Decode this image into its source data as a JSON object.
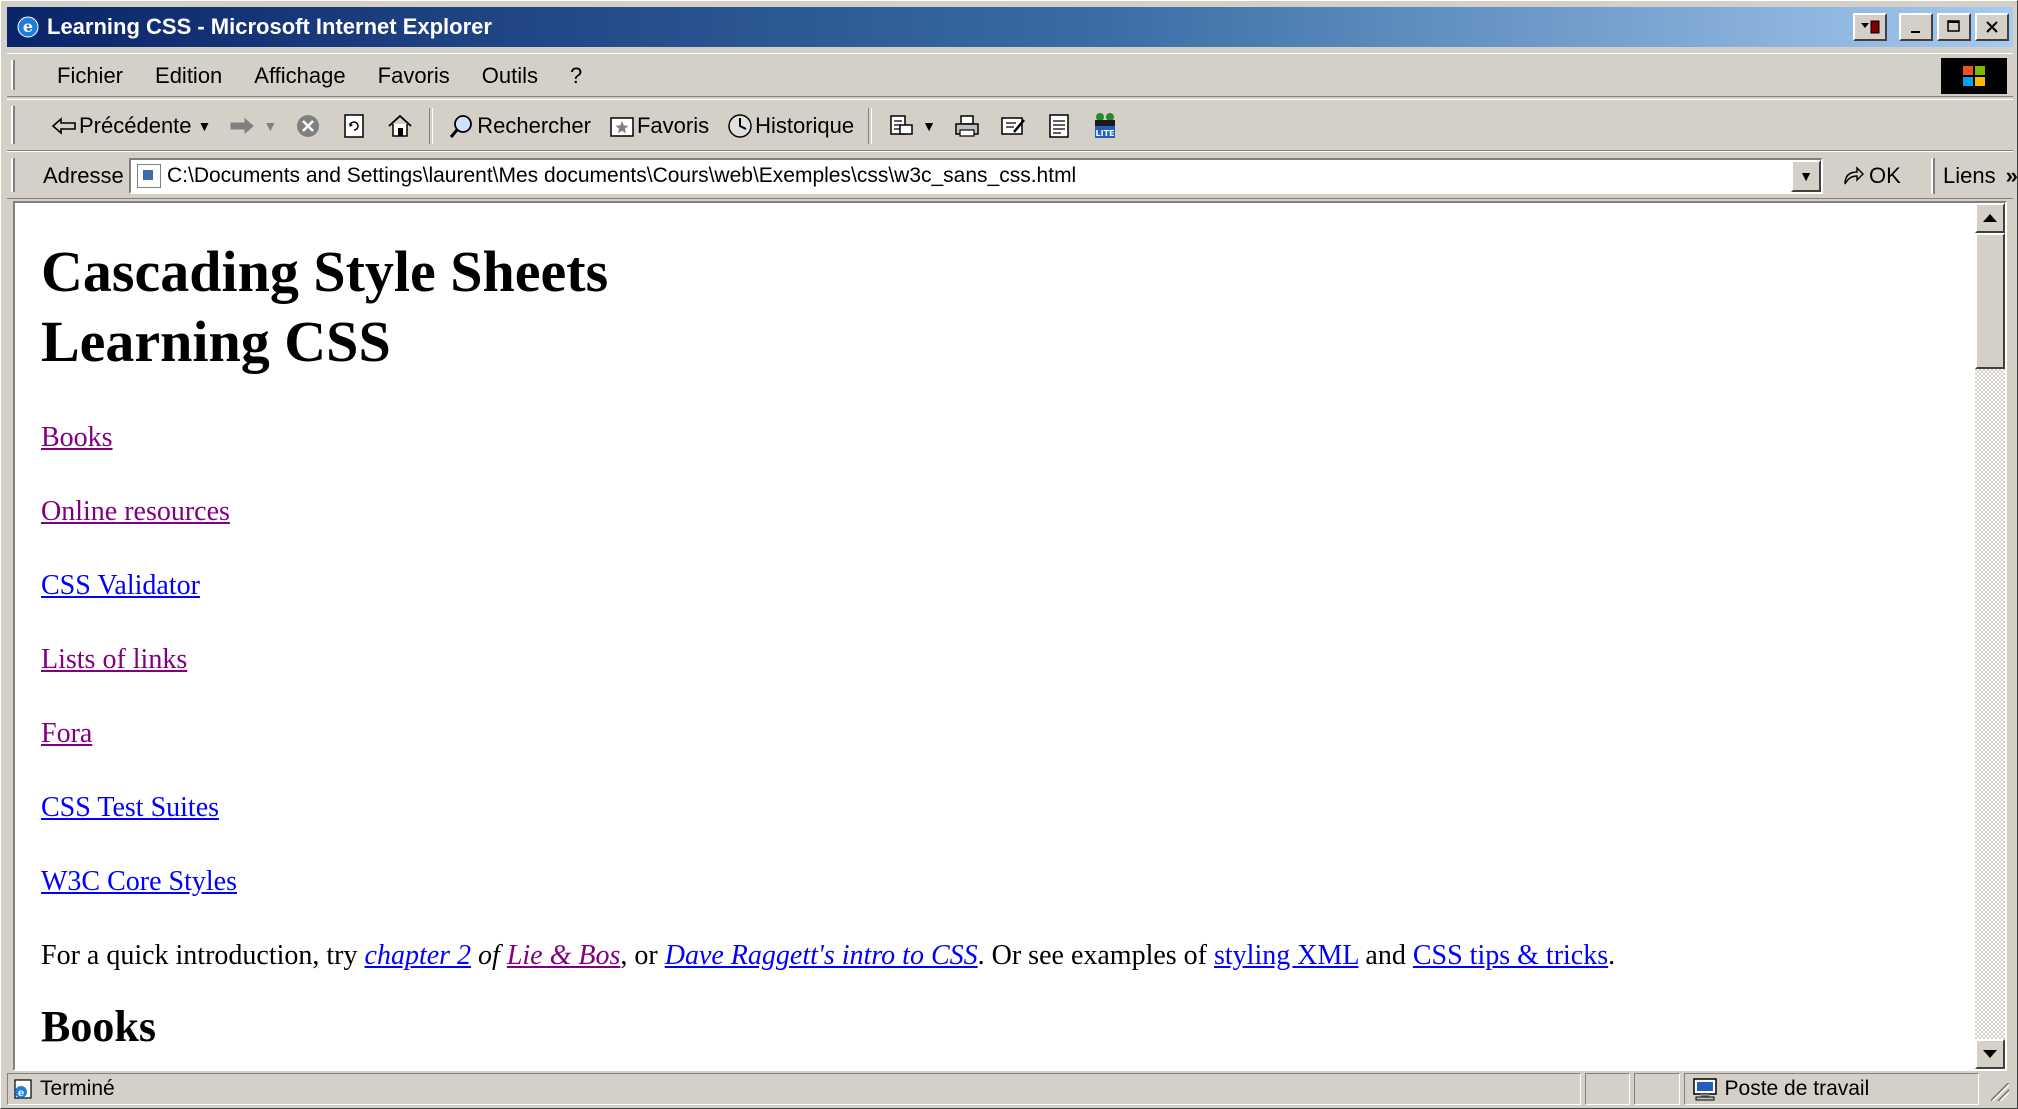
{
  "window": {
    "title": "Learning CSS - Microsoft Internet Explorer",
    "icon": "ie-icon",
    "controls": {
      "minimize": "_",
      "maximize": "□",
      "close": "✕"
    }
  },
  "menubar": {
    "items": [
      {
        "label": "Fichier"
      },
      {
        "label": "Edition"
      },
      {
        "label": "Affichage"
      },
      {
        "label": "Favoris"
      },
      {
        "label": "Outils"
      },
      {
        "label": "?"
      }
    ]
  },
  "toolbar": {
    "back_label": "Précédente",
    "search_label": "Rechercher",
    "favorites_label": "Favoris",
    "history_label": "Historique"
  },
  "addressbar": {
    "label": "Adresse",
    "value": "C:\\Documents and Settings\\laurent\\Mes documents\\Cours\\web\\Exemples\\css\\w3c_sans_css.html",
    "go_label": "OK",
    "links_label": "Liens"
  },
  "page": {
    "heading_line1": "Cascading Style Sheets",
    "heading_line2": "Learning CSS",
    "nav_links": [
      {
        "label": "Books",
        "visited": true
      },
      {
        "label": "Online resources",
        "visited": true
      },
      {
        "label": "CSS Validator",
        "visited": false
      },
      {
        "label": "Lists of links",
        "visited": true
      },
      {
        "label": "Fora",
        "visited": true
      },
      {
        "label": "CSS Test Suites",
        "visited": false
      },
      {
        "label": "W3C Core Styles",
        "visited": false
      }
    ],
    "intro": {
      "t1": "For a quick introduction, try ",
      "link_chapter": "chapter 2",
      "t2": " of ",
      "link_liebos": "Lie & Bos",
      "t3": ", or ",
      "link_raggett": "Dave Raggett's intro to CSS",
      "t4": ". Or see examples of ",
      "link_xml": "styling XML",
      "t5": " and ",
      "link_tips": "CSS tips & tricks",
      "t6": "."
    },
    "section_heading": "Books"
  },
  "statusbar": {
    "status_text": "Terminé",
    "zone_text": "Poste de travail"
  },
  "colors": {
    "title_gradient_start": "#0a246a",
    "title_gradient_end": "#a6caf0",
    "chrome": "#d4d0c8",
    "link": "#0000ff",
    "visited_link": "#800080"
  }
}
